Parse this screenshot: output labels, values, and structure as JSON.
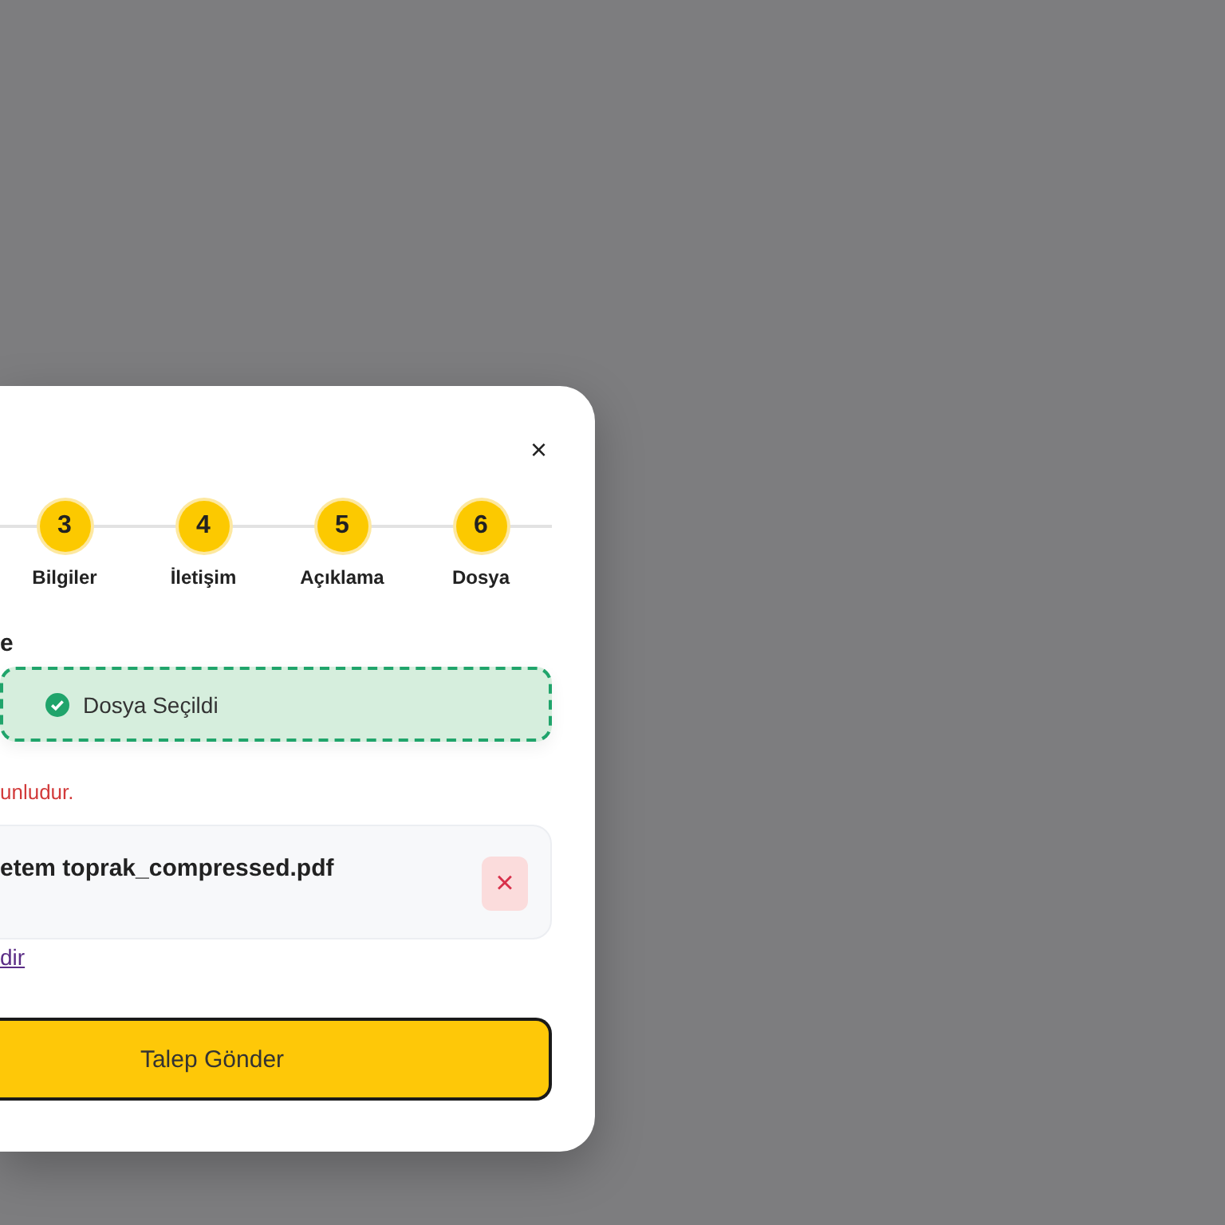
{
  "modal": {
    "close": "×",
    "steps": [
      {
        "number": "3",
        "label": "Bilgiler"
      },
      {
        "number": "4",
        "label": "İletişim"
      },
      {
        "number": "5",
        "label": "Açıklama"
      },
      {
        "number": "6",
        "label": "Dosya"
      }
    ],
    "field_label": "e",
    "dropzone": {
      "text": "Dosya Seçildi",
      "selected": true
    },
    "error": "unludur.",
    "file": {
      "name": "etem toprak_compressed.pdf",
      "remove": "×"
    },
    "link": "dir",
    "submit": "Talep Gönder"
  }
}
